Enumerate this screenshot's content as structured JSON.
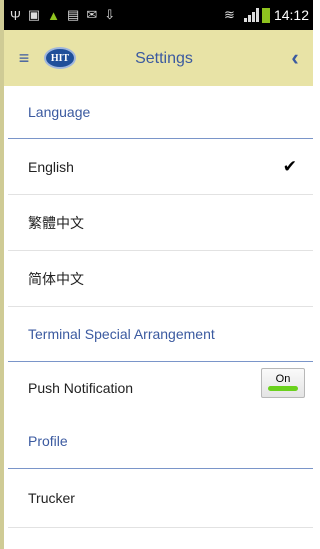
{
  "status_bar": {
    "left_icons": [
      "usb-icon",
      "image-icon",
      "android-icon",
      "file-icon",
      "mail-check-icon",
      "download-icon"
    ],
    "right_icons": [
      "wifi-icon",
      "signal-icon",
      "battery-icon"
    ],
    "time": "14:12"
  },
  "app_bar": {
    "logo_text": "HIT",
    "title": "Settings"
  },
  "sections": {
    "language": {
      "header": "Language",
      "options": [
        {
          "label": "English",
          "selected": true
        },
        {
          "label": "繁體中文",
          "selected": false
        },
        {
          "label": "简体中文",
          "selected": false
        }
      ]
    },
    "terminal": {
      "header": "Terminal Special Arrangement",
      "push_label": "Push Notification",
      "push_toggle": "On"
    },
    "profile": {
      "header": "Profile",
      "items": [
        {
          "label": "Trucker"
        }
      ]
    }
  },
  "colors": {
    "accent": "#3b5aa0",
    "app_bar": "#e8e3a6",
    "toggle_on": "#6ad11d"
  }
}
